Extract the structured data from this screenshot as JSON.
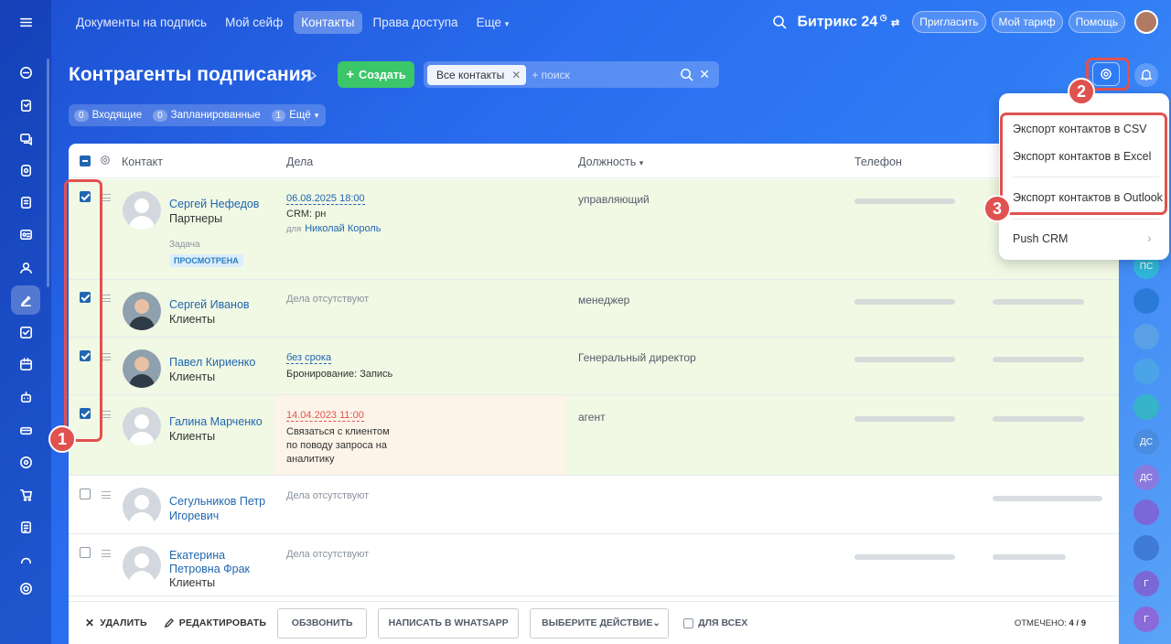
{
  "topnav": {
    "items": [
      {
        "label": "Документы на подпись"
      },
      {
        "label": "Мой сейф"
      },
      {
        "label": "Контакты"
      },
      {
        "label": "Права доступа"
      },
      {
        "label": "Еще"
      }
    ],
    "logo": "Битрикс 24",
    "invite_btn": "Пригласить",
    "plan_btn": "Мой тариф",
    "help_btn": "Помощь"
  },
  "page": {
    "title": "Контрагенты подписания",
    "create_btn": "Создать",
    "filter_chip": "Все контакты",
    "search_placeholder": "+ поиск",
    "counters": {
      "incoming_count": "0",
      "incoming_label": "Входящие",
      "planned_count": "0",
      "planned_label": "Запланированные",
      "more_count": "1",
      "more_label": "Ещё"
    }
  },
  "grid": {
    "headers": {
      "contact": "Контакт",
      "deals": "Дела",
      "position": "Должность",
      "phone": "Телефон"
    },
    "rows": [
      {
        "name": "Сергей Нефедов",
        "type": "Партнеры",
        "task_label": "Задача",
        "status": "ПРОСМОТРЕНА",
        "deal_date": "06.08.2025 18:00",
        "deal_title": "CRM: рн",
        "deal_for_label": "для",
        "deal_for_name": "Николай Король",
        "position": "управляющий",
        "checked": true
      },
      {
        "name": "Сергей Иванов",
        "type": "Клиенты",
        "deal_none": "Дела отсутствуют",
        "position": "менеджер",
        "checked": true
      },
      {
        "name": "Павел Кириенко",
        "type": "Клиенты",
        "deal_date": "без срока",
        "deal_title": "Бронирование: Запись",
        "position": "Генеральный директор",
        "checked": true
      },
      {
        "name": "Галина Марченко",
        "type": "Клиенты",
        "deal_date": "14.04.2023 11:00",
        "deal_title_l1": "Связаться с клиентом",
        "deal_title_l2": "по поводу запроса на",
        "deal_title_l3": "аналитику",
        "position": "агент",
        "checked": true
      },
      {
        "name_l1": "Сегульников Петр",
        "name_l2": "Игоревич",
        "deal_none": "Дела отсутствуют",
        "checked": false
      },
      {
        "name_l1": "Екатерина",
        "name_l2": "Петровна Фрак",
        "type": "Клиенты",
        "deal_none": "Дела отсутствуют",
        "checked": false
      }
    ]
  },
  "actionbar": {
    "delete": "УДАЛИТЬ",
    "edit": "РЕДАКТИРОВАТЬ",
    "call": "ОБЗВОНИТЬ",
    "whatsapp": "НАПИСАТЬ В WHATSAPP",
    "choose_action": "ВЫБЕРИТЕ ДЕЙСТВИЕ",
    "for_all": "ДЛЯ ВСЕХ",
    "marked_label": "ОТМЕЧЕНО:",
    "marked_value": "4 / 9"
  },
  "menu": {
    "items": [
      {
        "label": "Экспорт контактов в CSV"
      },
      {
        "label": "Экспорт контактов в Excel"
      },
      {
        "label": "Экспорт контактов в Outlook"
      },
      {
        "label": "Push CRM"
      }
    ]
  },
  "annotations": {
    "b1": "1",
    "b2": "2",
    "b3": "3"
  },
  "rightbar": {
    "avatars": [
      {
        "initials": "ПС",
        "color": "#2fb8d8"
      },
      {
        "initials": "",
        "color": "#2a7bd8"
      },
      {
        "initials": "",
        "color": "#5aa0e6"
      },
      {
        "initials": "",
        "color": "#4ba4e8"
      },
      {
        "initials": "",
        "color": "#37b4c8"
      },
      {
        "initials": "ДС",
        "color": "#4a8de0"
      },
      {
        "initials": "ДС",
        "color": "#8a7ae0"
      },
      {
        "initials": "",
        "color": "#7b68d8"
      },
      {
        "initials": "",
        "color": "#3f7ad6"
      },
      {
        "initials": "Г",
        "color": "#7a68d6"
      },
      {
        "initials": "Г",
        "color": "#8a6ad8"
      }
    ]
  },
  "colors": {
    "accent": "#2f7bf5",
    "create": "#3bc66a",
    "highlight": "#e0524f",
    "link": "#2067b0"
  }
}
